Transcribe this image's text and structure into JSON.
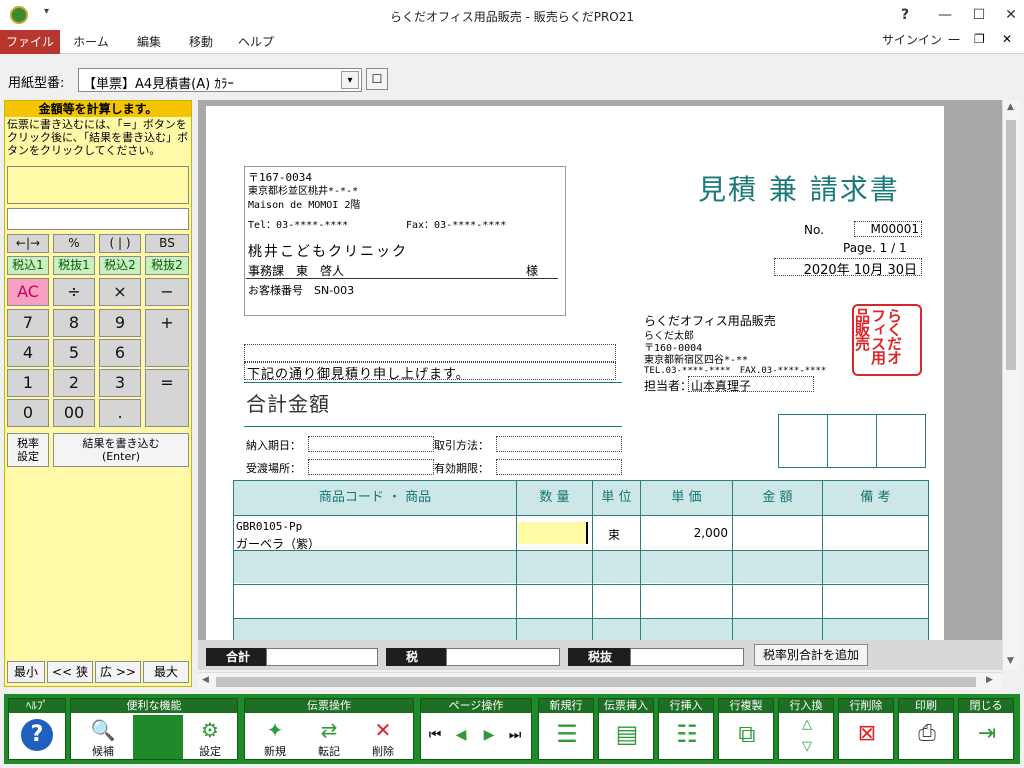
{
  "window": {
    "title": "らくだオフィス用品販売 - 販売らくだPRO21",
    "help": "?",
    "signin": "サインイン"
  },
  "ribbon_tabs": [
    "ファイル",
    "ホーム",
    "編集",
    "移動",
    "ヘルプ"
  ],
  "paper": {
    "label": "用紙型番:",
    "value": "【単票】A4見積書(A) ｶﾗｰ"
  },
  "calc": {
    "title": "金額等を計算します。",
    "instructions": "伝票に書き込むには、「=」ボタンをクリック後に、「結果を書き込む」ボタンをクリックしてください。",
    "keys": {
      "arrows": "←|→",
      "percent": "%",
      "paren": "( | )",
      "bs": "BS",
      "tax_in1": "税込1",
      "tax_out1": "税抜1",
      "tax_in2": "税込2",
      "tax_out2": "税抜2",
      "ac": "AC",
      "div": "÷",
      "mul": "×",
      "minus": "−",
      "plus": "+",
      "eq": "=",
      "n7": "7",
      "n8": "8",
      "n9": "9",
      "n4": "4",
      "n5": "5",
      "n6": "6",
      "n1": "1",
      "n2": "2",
      "n3": "3",
      "n0": "0",
      "n00": "00",
      "dot": "."
    },
    "tax_setting": "税率\n設定",
    "write_result": "結果を書き込む\n(Enter)",
    "nav": {
      "min": "最小",
      "narrow": "<< 狭",
      "wide": "広 >>",
      "max": "最大"
    }
  },
  "doc": {
    "customer_zip": "〒167-0034",
    "customer_addr1": "東京都杉並区桃井*-*-*",
    "customer_addr2": "Maison de MOMOI 2階",
    "customer_tel": "Tel：03-****-****",
    "customer_fax": "Fax：03-****-****",
    "customer_name": "桃井こどもクリニック",
    "customer_contact": "事務課　東　啓人",
    "honorific": "様",
    "customer_no": "お客様番号　SN-003",
    "title": "見積 兼 請求書",
    "no_label": "No.",
    "no_value": "M00001",
    "page": "Page. 1 / 1",
    "date": "2020年 10月 30日",
    "company_name": "らくだオフィス用品販売",
    "company_person": "らくだ太郎",
    "company_zip": "〒160-0004",
    "company_addr": "東京都新宿区四谷*-**",
    "company_tel": "TEL.03-****-****　FAX.03-****-****",
    "stamp": "らくだオフィス用品販売",
    "tanto_label": "担当者：",
    "tanto_value": "山本真理子",
    "message": "下記の通り御見積り申し上げます。",
    "total_label": "合計金額",
    "delivery_date": "納入期日：",
    "payment": "取引方法：",
    "delivery_place": "受渡場所：",
    "valid": "有効期限：",
    "columns": [
      "商品コード ・ 商品",
      "数 量",
      "単 位",
      "単 価",
      "金 額",
      "備 考"
    ],
    "items": [
      {
        "code": "GBR0105-Pp",
        "name": "ガーベラ（紫）",
        "qty": "",
        "unit": "束",
        "price": "2,000",
        "amount": "",
        "note": ""
      }
    ]
  },
  "totals": {
    "sum": "合計",
    "tax": "税",
    "pre_tax": "税抜",
    "add_button": "税率別合計を追加"
  },
  "toolbar": {
    "help_group": "ﾍﾙﾌﾟ",
    "useful_group": "便利な機能",
    "useful": {
      "candidate": "候補",
      "settings": "設定"
    },
    "slip_group": "伝票操作",
    "slip": {
      "new": "新規",
      "transfer": "転記",
      "delete": "削除"
    },
    "page_group": "ページ操作",
    "newline": "新規行",
    "insert_slip": "伝票挿入",
    "insert_row": "行挿入",
    "copy_row": "行複製",
    "swap_row": "行入換",
    "delete_row": "行削除",
    "print": "印刷",
    "close": "閉じる"
  },
  "colors": {
    "file_tab": "#b8362d",
    "teal": "#1a7a7a",
    "stamp_red": "#d9262a",
    "calc_bg": "#fff9a8",
    "toolbar_green": "#1f8a2a"
  }
}
